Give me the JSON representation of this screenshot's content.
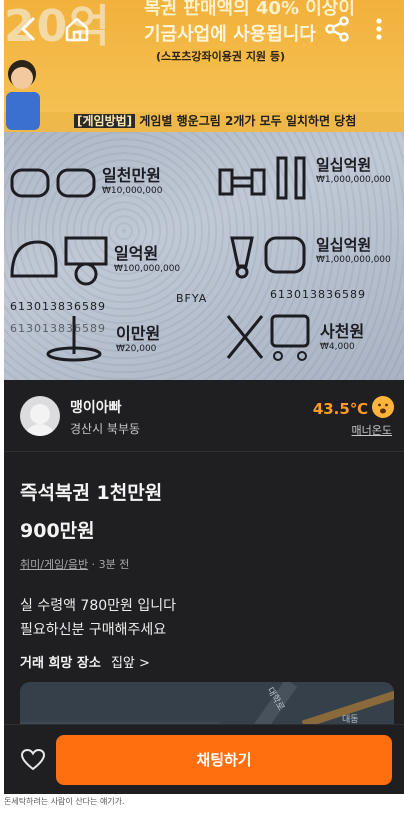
{
  "hero": {
    "poster_big": "20억",
    "poster_line1": "복권 판매액의 40% 이상이",
    "poster_line2": "기금사업에 사용됩니다",
    "poster_small": "(스포츠강좌이용권 지원 등)",
    "game_rule_tag": "[게임방법]",
    "game_rule_text": "게임별 행운그림 2개가 모두 일치하면 당첨",
    "prizes": [
      {
        "name": "일천만원",
        "amount": "₩10,000,000"
      },
      {
        "name": "일십억원",
        "amount": "₩1,000,000,000"
      },
      {
        "name": "일억원",
        "amount": "₩100,000,000"
      },
      {
        "name": "일십억원",
        "amount": "₩1,000,000,000"
      },
      {
        "name": "이만원",
        "amount": "₩20,000"
      },
      {
        "name": "사천원",
        "amount": "₩4,000"
      }
    ],
    "code_left": "613013836589",
    "code_mid": "BFYA",
    "code_right": "613013836589",
    "code_bottom": "613013836589"
  },
  "icons": {
    "back": "back-arrow-icon",
    "home": "home-icon",
    "share": "share-icon",
    "more": "more-vertical-icon",
    "heart": "heart-icon",
    "temp": "smiley-icon"
  },
  "seller": {
    "name": "맹이아빠",
    "location": "경산시 북부동",
    "temperature": "43.5℃",
    "manner_label": "매너온도"
  },
  "post": {
    "title": "즉석복권 1천만원",
    "price": "900만원",
    "category": "취미/게임/음반",
    "time": " · 3분 전",
    "desc_line1": "실 수령액 780만원 입니다",
    "desc_line2": "필요하신분 구매해주세요",
    "place_label": "거래 희망 장소",
    "place_value": "집앞 >"
  },
  "map": {
    "label1": "대학로",
    "label2": "대동"
  },
  "bottom": {
    "chat_label": "채팅하기"
  },
  "caption": "돈세탁하려는 사람이 산다는 얘기가.",
  "colors": {
    "accent": "#ff6f0f",
    "temperature": "#ff9a26",
    "background": "#1f1f21"
  }
}
